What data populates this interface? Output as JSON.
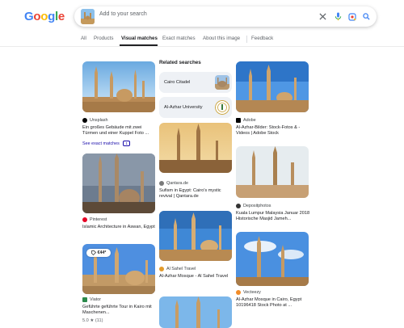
{
  "header": {
    "logo": [
      "G",
      "o",
      "o",
      "g",
      "l",
      "e"
    ],
    "logo_colors": [
      "#4285F4",
      "#EA4335",
      "#FBBC05",
      "#4285F4",
      "#34A853",
      "#EA4335"
    ],
    "search_placeholder": "Add to your search"
  },
  "tabs": [
    "All",
    "Products",
    "Visual matches",
    "Exact matches",
    "About this image",
    "Feedback"
  ],
  "active_tab": "Visual matches",
  "col1": [
    {
      "source": "Unsplash",
      "title": "Ein großes Gebäude mit zwei Türmen und einer Kuppel Foto ...",
      "link": "See exact matches",
      "link_count": "1"
    },
    {
      "source": "Pinterest",
      "title": "Islamic Architecture in Aswan, Egypt"
    },
    {
      "source": "Viator",
      "title": "Geführte geführte Tour in Kairo mit Maschenen...",
      "rating": "5.0 ★ (11)",
      "price": "€44*"
    }
  ],
  "related": {
    "title": "Related searches",
    "items": [
      "Cairo Citadel",
      "Al-Azhar University"
    ]
  },
  "col2": [
    {
      "source": "Qantara.de",
      "title": "Sufism in Egypt: Cairo's mystic revival | Qantara.de"
    },
    {
      "source": "Al Sahel Travel",
      "title": "Al-Azhar Mosque - Al Sahel Travel"
    }
  ],
  "col3": [
    {
      "source": "Adobe",
      "title": "Al-Azhar-Bilder: Stock-Fotos & -Videos | Adobe Stock"
    },
    {
      "source": "Depositphotos",
      "title": "Kuala Lumpur Malaysia Januar 2018 Historische Masjid Jameh..."
    },
    {
      "source": "Vecteezy",
      "title": "Al-Azhar Mosque in Cairo, Egypt 10196418 Stock Photo at ..."
    }
  ]
}
